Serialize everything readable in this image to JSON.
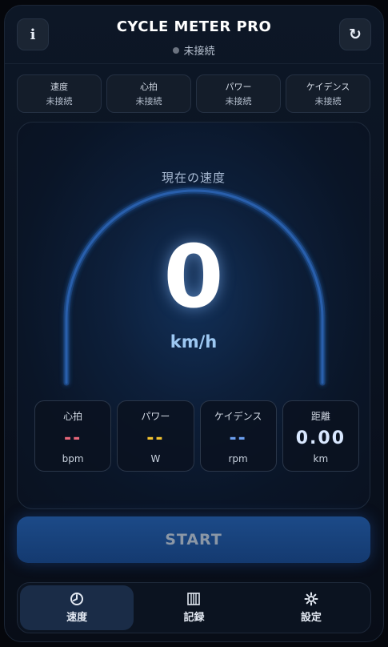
{
  "header": {
    "info_label": "i",
    "title": "CYCLE METER PRO",
    "status": "未接続",
    "refresh_label": "↻"
  },
  "sensors": [
    {
      "name": "速度",
      "state": "未接続"
    },
    {
      "name": "心拍",
      "state": "未接続"
    },
    {
      "name": "パワー",
      "state": "未接続"
    },
    {
      "name": "ケイデンス",
      "state": "未接続"
    }
  ],
  "speed": {
    "caption": "現在の速度",
    "value": "0",
    "unit": "km/h"
  },
  "stats": [
    {
      "label": "心拍",
      "value": "--",
      "unit": "bpm",
      "color": "#e8677a"
    },
    {
      "label": "パワー",
      "value": "--",
      "unit": "W",
      "color": "#f2c230"
    },
    {
      "label": "ケイデンス",
      "value": "--",
      "unit": "rpm",
      "color": "#6b9ff0"
    },
    {
      "label": "距離",
      "value": "0.00",
      "unit": "km",
      "color": "#d9e8ff"
    }
  ],
  "start_label": "START",
  "nav": [
    {
      "label": "速度",
      "icon": "speedometer-icon",
      "active": true
    },
    {
      "label": "記録",
      "icon": "records-icon",
      "active": false
    },
    {
      "label": "設定",
      "icon": "gear-icon",
      "active": false
    }
  ],
  "colors": {
    "accent": "#1c4a88",
    "gauge_arc": "#2d66b8"
  }
}
